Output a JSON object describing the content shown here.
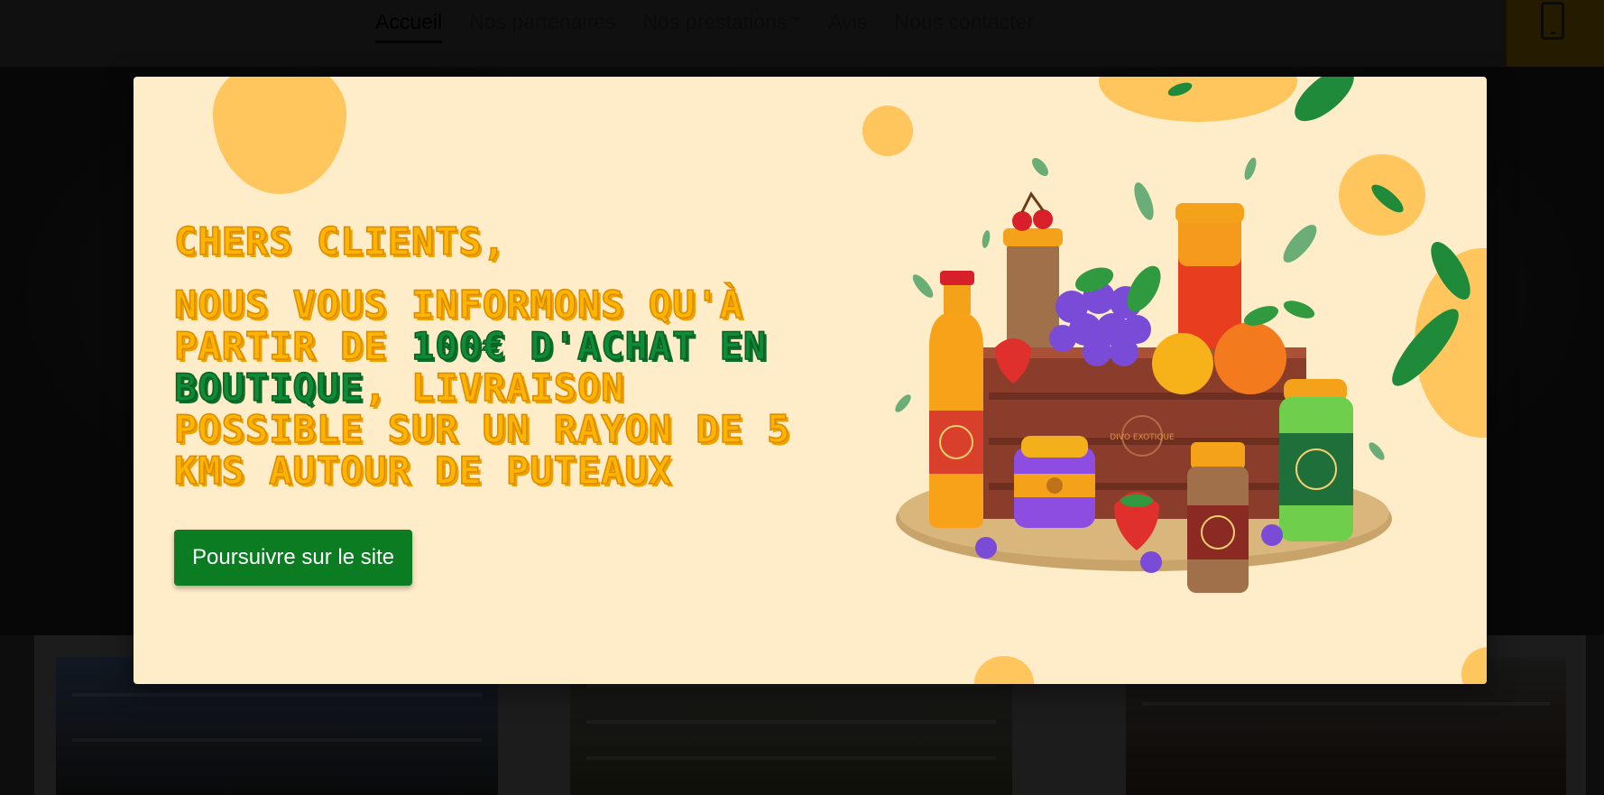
{
  "nav": {
    "items": [
      {
        "label": "Accueil",
        "active": true
      },
      {
        "label": "Nos partenaires"
      },
      {
        "label": "Nos prestations",
        "has_dropdown": true
      },
      {
        "label": "Avis"
      },
      {
        "label": "Nous contacter"
      }
    ],
    "phone_icon": "phone-icon"
  },
  "modal": {
    "salutation": "Chers clients,",
    "message_part1": "Nous vous informons qu'à partir de ",
    "message_highlight": "100€ d'achat en boutique",
    "message_part2": ", livraison possible sur un rayon de 5 kms autour de Puteaux",
    "button_label": "Poursuivre sur le site",
    "illustration_icon": "fruit-crate-illustration",
    "label_text": "DIVO EXOTIQUE"
  },
  "colors": {
    "modal_bg": "#ffecc8",
    "headline_orange": "#ffb400",
    "headline_green": "#0f8a35",
    "button_bg": "#0b7c22",
    "blob": "#ffc65e"
  }
}
